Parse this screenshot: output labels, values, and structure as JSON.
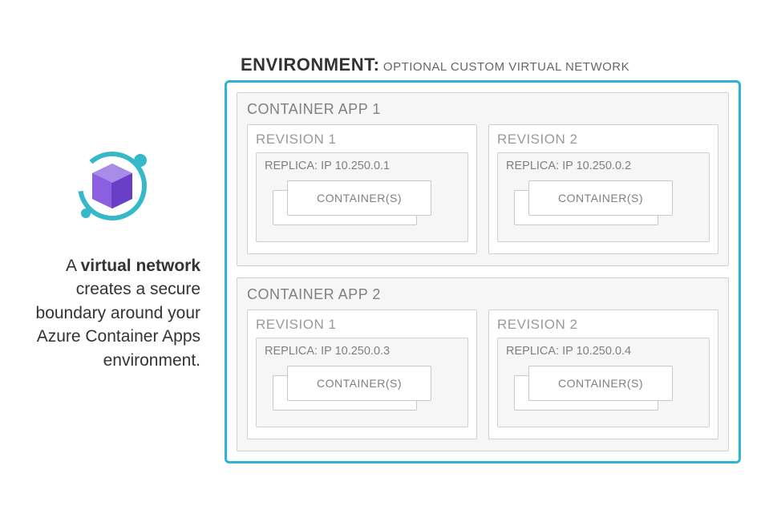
{
  "description": {
    "prefix": "A ",
    "bold": "virtual network",
    "rest": " creates a secure boundary around your Azure Container Apps environment."
  },
  "environment": {
    "title": "ENVIRONMENT:",
    "subtitle": "OPTIONAL CUSTOM VIRTUAL NETWORK",
    "apps": [
      {
        "title": "CONTAINER APP 1",
        "revisions": [
          {
            "title": "REVISION 1",
            "replica": "REPLICA: IP 10.250.0.1",
            "container": "CONTAINER(S)"
          },
          {
            "title": "REVISION 2",
            "replica": "REPLICA: IP 10.250.0.2",
            "container": "CONTAINER(S)"
          }
        ]
      },
      {
        "title": "CONTAINER APP 2",
        "revisions": [
          {
            "title": "REVISION 1",
            "replica": "REPLICA: IP 10.250.0.3",
            "container": "CONTAINER(S)"
          },
          {
            "title": "REVISION 2",
            "replica": "REPLICA: IP 10.250.0.4",
            "container": "CONTAINER(S)"
          }
        ]
      }
    ]
  }
}
